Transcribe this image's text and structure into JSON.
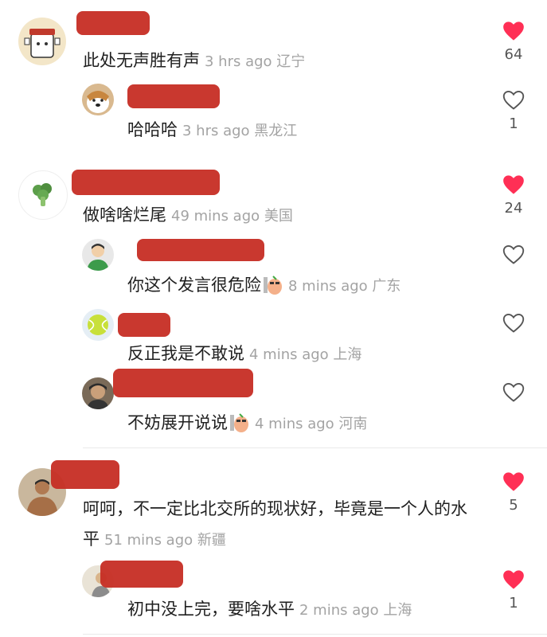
{
  "comments": [
    {
      "text": "此处无声胜有声",
      "time": "3 hrs ago",
      "location": "辽宁",
      "likes": "64",
      "liked": true,
      "replies": [
        {
          "text": "哈哈哈",
          "time": "3 hrs ago",
          "location": "黑龙江",
          "likes": "1",
          "liked": false
        }
      ]
    },
    {
      "text": "做啥啥烂尾",
      "time": "49 mins ago",
      "location": "美国",
      "likes": "24",
      "liked": true,
      "replies": [
        {
          "text": "你这个发言很危险",
          "time": "8 mins ago",
          "location": "广东",
          "likes": "",
          "liked": false,
          "sticker": "bean-glasses-sticker"
        },
        {
          "text": "反正我是不敢说",
          "time": "4 mins ago",
          "location": "上海",
          "likes": "",
          "liked": false
        },
        {
          "text": "不妨展开说说",
          "time": "4 mins ago",
          "location": "河南",
          "likes": "",
          "liked": false,
          "sticker": "bean-glasses-sticker"
        }
      ]
    },
    {
      "text": "呵呵，不一定比北交所的现状好，毕竟是一个人的水平",
      "time": "51 mins ago",
      "location": "新疆",
      "likes": "5",
      "liked": true,
      "replies": [
        {
          "text": "初中没上完，要啥水平",
          "time": "2 mins ago",
          "location": "上海",
          "likes": "1",
          "liked": true
        }
      ]
    }
  ],
  "colors": {
    "liked": "#ff2f55",
    "unliked": "#555555",
    "redaction": "#c62d24"
  }
}
